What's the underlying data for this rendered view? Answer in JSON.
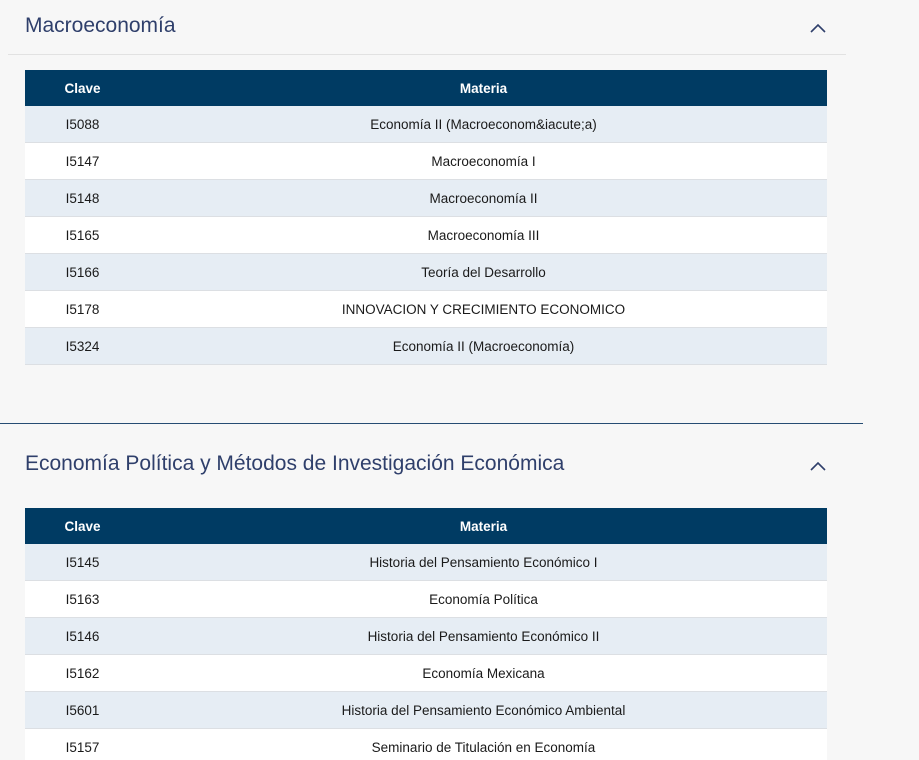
{
  "sections": [
    {
      "title": "Macroeconomía",
      "columns": {
        "clave": "Clave",
        "materia": "Materia"
      },
      "rows": [
        {
          "clave": "I5088",
          "materia": "Economía II (Macroeconom&iacute;a)"
        },
        {
          "clave": "I5147",
          "materia": "Macroeconomía I"
        },
        {
          "clave": "I5148",
          "materia": "Macroeconomía II"
        },
        {
          "clave": "I5165",
          "materia": "Macroeconomía III"
        },
        {
          "clave": "I5166",
          "materia": "Teoría del Desarrollo"
        },
        {
          "clave": "I5178",
          "materia": "INNOVACION Y CRECIMIENTO ECONOMICO"
        },
        {
          "clave": "I5324",
          "materia": "Economía II (Macroeconomía)"
        }
      ]
    },
    {
      "title": "Economía Política y Métodos de Investigación Económica",
      "columns": {
        "clave": "Clave",
        "materia": "Materia"
      },
      "rows": [
        {
          "clave": "I5145",
          "materia": "Historia del Pensamiento Económico I"
        },
        {
          "clave": "I5163",
          "materia": "Economía Política"
        },
        {
          "clave": "I5146",
          "materia": "Historia del Pensamiento Económico II"
        },
        {
          "clave": "I5162",
          "materia": "Economía Mexicana"
        },
        {
          "clave": "I5601",
          "materia": "Historia del Pensamiento Económico Ambiental"
        },
        {
          "clave": "I5157",
          "materia": "Seminario de Titulación en Economía"
        }
      ]
    }
  ],
  "icons": {
    "collapse": "chevron-up-icon"
  },
  "colors": {
    "table_header": "#003b63",
    "row_alt": "#e6edf4",
    "title": "#2f3f6b",
    "divider": "#264c73"
  }
}
